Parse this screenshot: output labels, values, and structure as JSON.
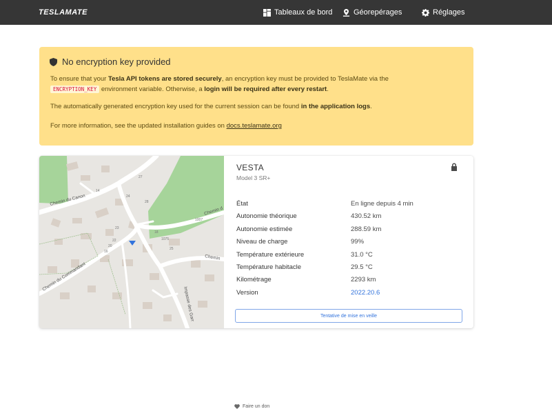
{
  "nav": {
    "brand": "TESLAMATE",
    "dashboards": "Tableaux de bord",
    "geofences": "Géorepérages",
    "settings": "Réglages"
  },
  "notice": {
    "title": "No encryption key provided",
    "p1_a": "To ensure that your ",
    "p1_b": "Tesla API tokens are stored securely",
    "p1_c": ", an encryption key must be provided to TeslaMate via the",
    "p1_code": "ENCRYPTION_KEY",
    "p1_d": " environment variable. Otherwise, a ",
    "p1_e": "login will be required after every restart",
    "p1_f": ".",
    "p2_a": "The automatically generated encryption key used for the current session can be found ",
    "p2_b": "in the application logs",
    "p2_c": ".",
    "p3_a": "For more information, see the updated installation guides on ",
    "p3_link": "docs.teslamate.org"
  },
  "car": {
    "name": "VESTA",
    "model": "Model 3 SR+",
    "rows": [
      {
        "label": "État",
        "value": "En ligne depuis 4 min"
      },
      {
        "label": "Autonomie théorique",
        "value": "430.52 km"
      },
      {
        "label": "Autonomie estimée",
        "value": "288.59 km"
      },
      {
        "label": "Niveau de charge",
        "value": "99%"
      },
      {
        "label": "Température extérieure",
        "value": "31.0 °C"
      },
      {
        "label": "Température habitacle",
        "value": "29.5 °C"
      },
      {
        "label": "Kilométrage",
        "value": "2293 km"
      },
      {
        "label": "Version",
        "value": "2022.20.6"
      }
    ],
    "sleep_button": "Tentative de mise en veille"
  },
  "map": {
    "streets": [
      "Chemin du Canon",
      "Chemin du Commandant",
      "Impasse des Garr",
      "Chemin",
      "Chemin d"
    ],
    "house_numbers": [
      "27",
      "14",
      "24",
      "28",
      "23",
      "22",
      "20",
      "16",
      "18",
      "1075",
      "25",
      "1007"
    ]
  },
  "footer": {
    "donate": "Faire un don"
  },
  "colors": {
    "navbar": "#363636",
    "warning": "#ffe08a",
    "link": "#3273dc",
    "map_green": "#a6d49a"
  }
}
